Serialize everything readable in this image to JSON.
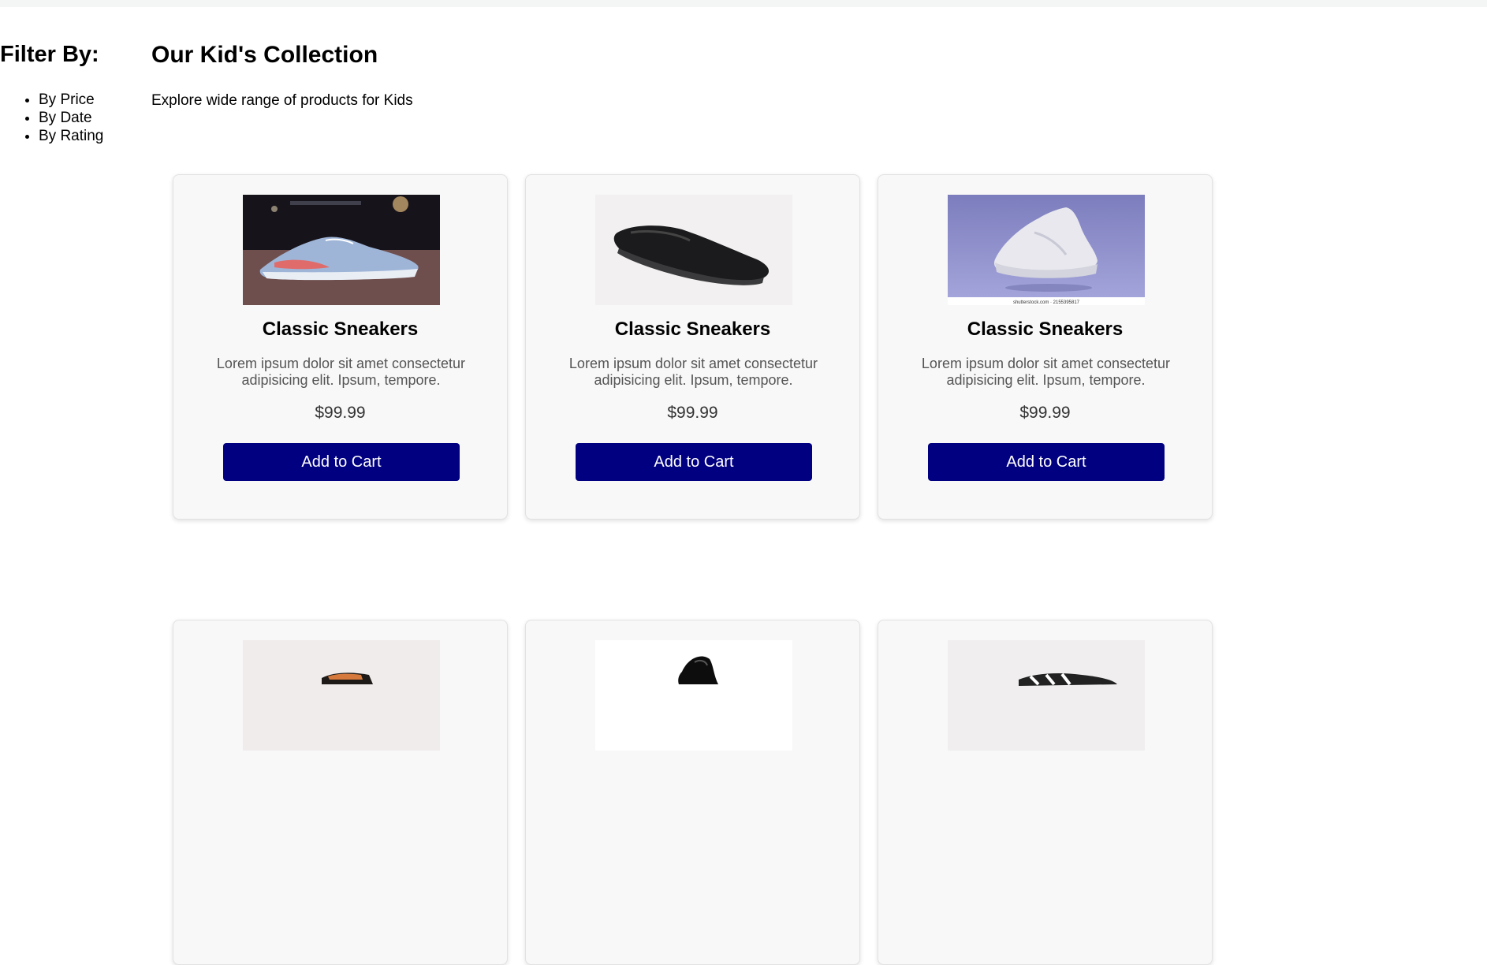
{
  "filter": {
    "title": "Filter By:",
    "options": [
      "By Price",
      "By Date",
      "By Rating"
    ]
  },
  "collection": {
    "title": "Our Kid's Collection",
    "subtitle": "Explore wide range of products for Kids"
  },
  "products": [
    {
      "name": "Classic Sneakers",
      "description": "Lorem ipsum dolor sit amet consectetur adipisicing elit. Ipsum, tempore.",
      "price": "$99.99",
      "button": "Add to Cart",
      "image": "blue-running-sneaker"
    },
    {
      "name": "Classic Sneakers",
      "description": "Lorem ipsum dolor sit amet consectetur adipisicing elit. Ipsum, tempore.",
      "price": "$99.99",
      "button": "Add to Cart",
      "image": "black-loafer"
    },
    {
      "name": "Classic Sneakers",
      "description": "Lorem ipsum dolor sit amet consectetur adipisicing elit. Ipsum, tempore.",
      "price": "$99.99",
      "button": "Add to Cart",
      "image": "white-floating-sneaker",
      "image_caption": "shutterstock.com · 2155395817"
    },
    {
      "image": "orange-black-shoe"
    },
    {
      "image": "black-shoe"
    },
    {
      "image": "striped-sneaker"
    }
  ],
  "colors": {
    "button": "#000080",
    "card_background": "#f8f8f8",
    "text_muted": "#555555"
  }
}
